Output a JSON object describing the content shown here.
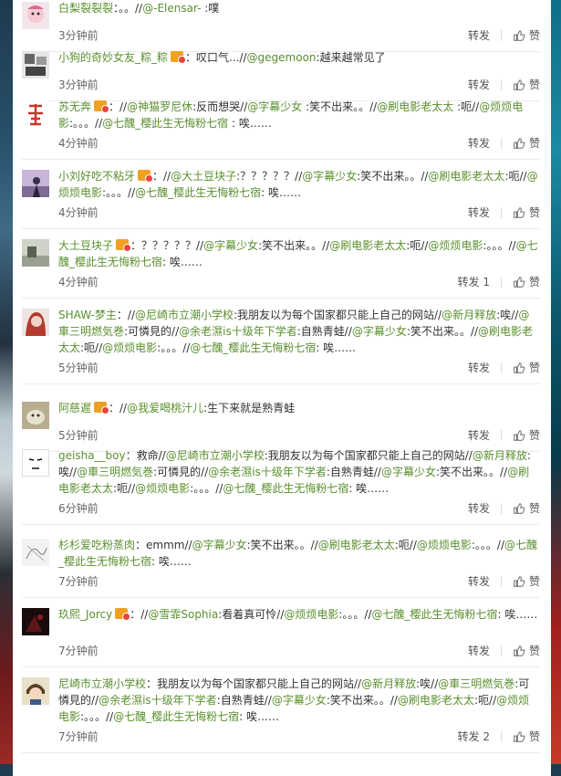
{
  "labels": {
    "forward": "转发",
    "like": "赞",
    "more": "……"
  },
  "colors": {
    "accent": "#5a8f2e"
  },
  "comments": [
    {
      "user": "白梨裂裂裂",
      "vip": false,
      "body_html": "<span class='user'>白梨裂裂裂</span>：。。//<span class='ment'>@-Elensar-</span> :噗",
      "time": "3分钟前",
      "forward": "转发",
      "avatar": "pink-character"
    },
    {
      "user": "小狗的奇妙女友_粽_粽",
      "vip": true,
      "body_html": "<span class='user'>小狗的奇妙女友_粽_粽</span><span class='vip' data-name='vip-badge-icon' data-interactable='false'></span>：叹口气...//<span class='ment'>@gegemoon</span>:越来越常见了",
      "time": "3分钟前",
      "forward": "转发",
      "avatar": "grey-manga"
    },
    {
      "user": "苏无奔",
      "vip": true,
      "body_html": "<span class='user'>苏无奔</span><span class='vip' data-name='vip-badge-icon' data-interactable='false'></span>：//<span class='ment'>@神猫罗尼休</span>:反而想哭//<span class='ment'>@字幕少女</span> :笑不出来。。//<span class='ment'>@刷电影老太太</span> :呃//<span class='ment'>@烦烦电影</span>:。。。//<span class='ment'>@七醜_樱此生无悔粉七宿</span> : 唉……",
      "time": "4分钟前",
      "forward": "转发",
      "avatar": "red-glyph"
    },
    {
      "user": "小刘好吃不粘牙",
      "vip": true,
      "body_html": "<span class='user'>小刘好吃不粘牙</span><span class='vip' data-name='vip-badge-icon' data-interactable='false'></span>：//<span class='ment'>@大土豆块子</span>:？？？？？//<span class='ment'>@字幕少女</span>:笑不出来。。//<span class='ment'>@刷电影老太太</span>:呃//<span class='ment'>@烦烦电影</span>:。。。//<span class='ment'>@七醜_樱此生无悔粉七宿</span>: 唉……",
      "time": "4分钟前",
      "forward": "转发",
      "avatar": "purple-figure"
    },
    {
      "user": "大土豆块子",
      "vip": true,
      "body_html": "<span class='user'>大土豆块子</span><span class='vip' data-name='vip-badge-icon' data-interactable='false'></span>：？？？？？//<span class='ment'>@字幕少女</span>:笑不出来。。//<span class='ment'>@刷电影老太太</span>:呃//<span class='ment'>@烦烦电影</span>:。。。//<span class='ment'>@七醜_樱此生无悔粉七宿</span>: 唉……",
      "time": "4分钟前",
      "forward": "转发 1",
      "avatar": "room-photo"
    },
    {
      "user": "SHAW-梦主",
      "vip": false,
      "body_html": "<span class='user'>SHAW-梦主</span>：//<span class='ment'>@尼崎市立潮小学校</span>:我朋友以为每个国家都只能上自己的网站//<span class='ment'>@新月释放</span>:唉//<span class='ment'>@車三明燃気巻</span>:可憐見的//<span class='ment'>@余老濕is十级年下学者</span>:自熟青蛙//<span class='ment'>@字幕少女</span>:笑不出来。。//<span class='ment'>@刷电影老太太</span>:呃//<span class='ment'>@烦烦电影</span>:。。。//<span class='ment'>@七醜_樱此生无悔粉七宿</span>: 唉……",
      "time": "5分钟前",
      "forward": "转发",
      "avatar": "red-hair"
    },
    {
      "user": "阿慈遲",
      "vip": true,
      "body_html": "<span class='user'>阿慈遲</span><span class='vip' data-name='vip-badge-icon' data-interactable='false'></span>：//<span class='ment'>@我爱喝桃汁儿</span>:生下来就是熟青蛙",
      "time": "5分钟前",
      "forward": "转发",
      "avatar": "cat-photo"
    },
    {
      "user": "geisha__boy",
      "vip": false,
      "body_html": "<span class='user'>geisha__boy</span>：救命//<span class='ment'>@尼崎市立潮小学校</span>:我朋友以为每个国家都只能上自己的网站//<span class='ment'>@新月释放</span>:唉//<span class='ment'>@車三明燃気巻</span>:可憐見的//<span class='ment'>@余老濕is十级年下学者</span>:自熟青蛙//<span class='ment'>@字幕少女</span>:笑不出来。。//<span class='ment'>@刷电影老太太</span>:呃//<span class='ment'>@烦烦电影</span>:。。。//<span class='ment'>@七醜_樱此生无悔粉七宿</span>: 唉……",
      "time": "6分钟前",
      "forward": "转发",
      "avatar": "face-sketch"
    },
    {
      "user": "杉杉爱吃粉蒸肉",
      "vip": false,
      "body_html": "<span class='user'>杉杉爱吃粉蒸肉</span>：emmm//<span class='ment'>@字幕少女</span>:笑不出来。。//<span class='ment'>@刷电影老太太</span>:呃//<span class='ment'>@烦烦电影</span>:。。。//<span class='ment'>@七醜_樱此生无悔粉七宿</span>: 唉……",
      "time": "7分钟前",
      "forward": "转发",
      "avatar": "sketch"
    },
    {
      "user": "玖熙_Jorcy",
      "vip": true,
      "body_html": "<span class='user'>玖熙_Jorcy</span><span class='vip' data-name='vip-badge-icon' data-interactable='false'></span>：//<span class='ment'>@雪霏Sophia</span>:看着真可怜//<span class='ment'>@烦烦电影</span>:。。。//<span class='ment'>@七醜_樱此生无悔粉七宿</span>: 唉……",
      "time": "7分钟前",
      "forward": "转发",
      "avatar": "dark-red"
    },
    {
      "user": "尼崎市立潮小学校",
      "vip": false,
      "body_html": "<span class='user'>尼崎市立潮小学校</span>：我朋友以为每个国家都只能上自己的网站//<span class='ment'>@新月释放</span>:唉//<span class='ment'>@車三明燃気巻</span>:可憐見的//<span class='ment'>@余老濕is十级年下学者</span>:自熟青蛙//<span class='ment'>@字幕少女</span>:笑不出来。。//<span class='ment'>@刷电影老太太</span>:呃//<span class='ment'>@烦烦电影</span>:。。。//<span class='ment'>@七醜_樱此生无悔粉七宿</span>: 唉……",
      "time": "7分钟前",
      "forward": "转发 2",
      "avatar": "anime-boy"
    }
  ]
}
